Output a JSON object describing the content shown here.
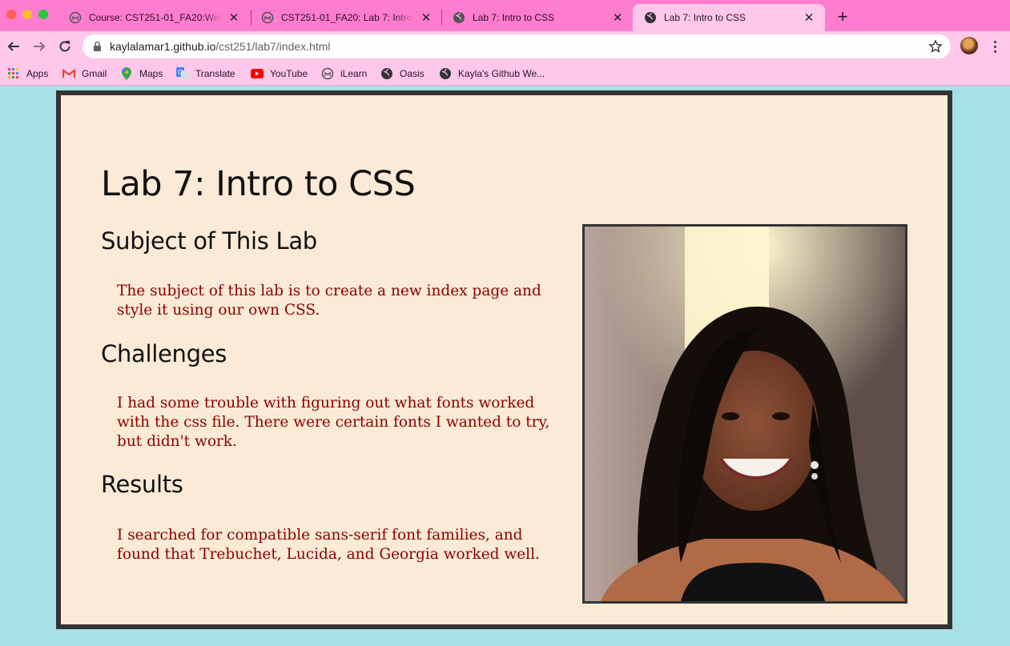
{
  "browser": {
    "tabs": [
      {
        "title": "Course: CST251-01_FA20:Web",
        "icon": "moodle-icon",
        "active": false
      },
      {
        "title": "CST251-01_FA20: Lab 7: Intro t",
        "icon": "moodle-icon",
        "active": false
      },
      {
        "title": "Lab 7: Intro to CSS",
        "icon": "globe-icon",
        "active": false
      },
      {
        "title": "Lab 7: Intro to CSS",
        "icon": "globe-icon",
        "active": true
      }
    ],
    "close_glyph": "✕",
    "new_tab_glyph": "+",
    "url_host": "kaylalamar1.github.io",
    "url_path": "/cst251/lab7/index.html",
    "bookmarks": [
      {
        "label": "Apps",
        "icon": "apps-grid-icon"
      },
      {
        "label": "Gmail",
        "icon": "gmail-icon"
      },
      {
        "label": "Maps",
        "icon": "maps-icon"
      },
      {
        "label": "Translate",
        "icon": "translate-icon"
      },
      {
        "label": "YouTube",
        "icon": "youtube-icon"
      },
      {
        "label": "iLearn",
        "icon": "moodle-icon"
      },
      {
        "label": "Oasis",
        "icon": "globe-icon"
      },
      {
        "label": "Kayla's Github We...",
        "icon": "github-icon"
      }
    ],
    "colors": {
      "tab_strip": "#ff7dcf",
      "toolbar": "#ffc8ea"
    }
  },
  "page": {
    "title": "Lab 7: Intro to CSS",
    "sections": [
      {
        "heading": "Subject of This Lab",
        "text": "The subject of this lab is to create a new index page and style it using our own CSS."
      },
      {
        "heading": "Challenges",
        "text": "I had some trouble with figuring out what fonts worked with the css file. There were certain fonts I wanted to try, but didn't work."
      },
      {
        "heading": "Results",
        "text": "I searched for compatible sans-serif font families, and found that Trebuchet, Lucida, and Georgia worked well."
      }
    ],
    "colors": {
      "background": "#a8e0e7",
      "card": "#fbead6",
      "border": "#333333",
      "text": "#8b0000"
    }
  }
}
